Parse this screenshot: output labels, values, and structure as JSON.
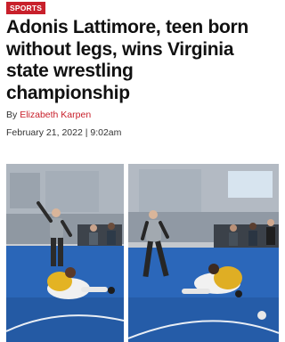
{
  "article": {
    "category": "SPORTS",
    "headline_lines": [
      "Adonis Lattimore, teen born",
      "without legs, wins Virginia",
      "state wrestling",
      "championship"
    ],
    "byline_prefix": "By",
    "author": "Elizabeth Karpen",
    "date": "February 21, 2022 | 9:02am"
  },
  "photos": [
    {
      "name": "left-frame"
    },
    {
      "name": "right-frame"
    }
  ],
  "colors": {
    "brand_red": "#c8202b",
    "mat_blue": "#2a66b8"
  }
}
